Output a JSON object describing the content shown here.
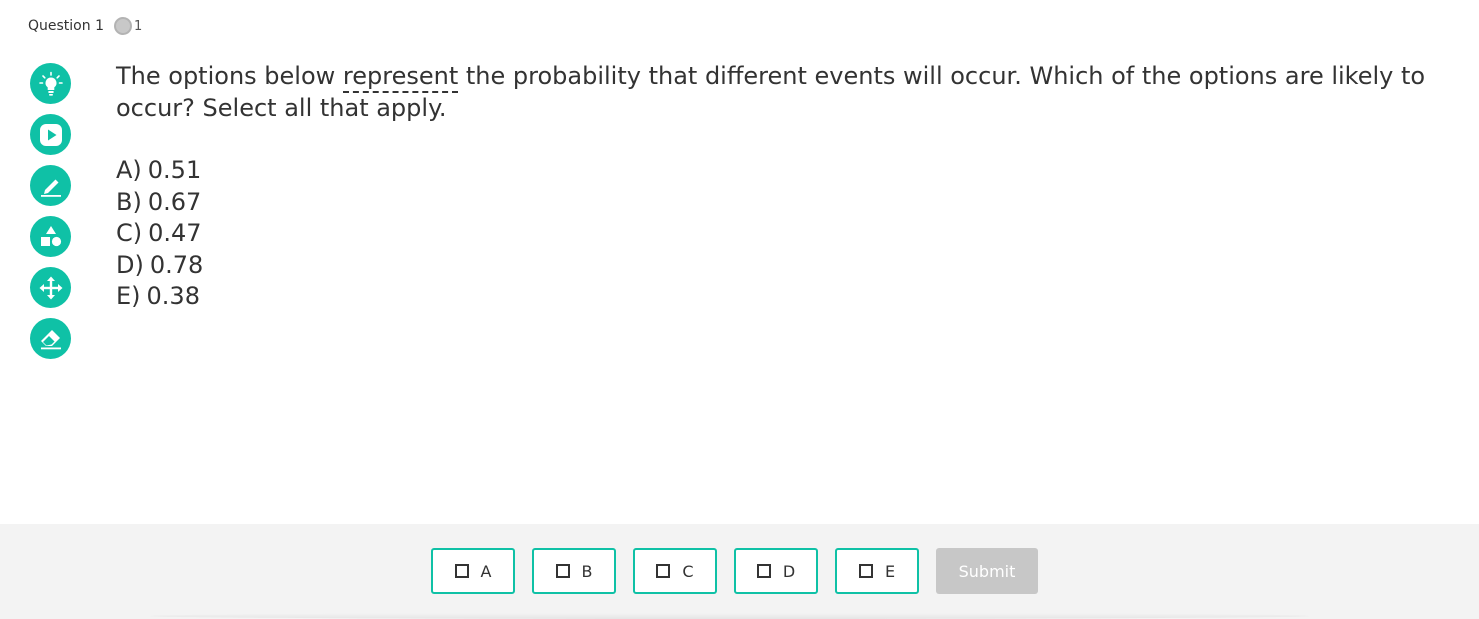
{
  "header": {
    "question_label": "Question 1",
    "points": "1"
  },
  "toolbar": {
    "tools": [
      {
        "name": "hint",
        "icon": "lightbulb-icon"
      },
      {
        "name": "video",
        "icon": "play-icon"
      },
      {
        "name": "scratchpad",
        "icon": "pencil-icon"
      },
      {
        "name": "manipulatives",
        "icon": "shapes-icon"
      },
      {
        "name": "move",
        "icon": "move-arrows-icon"
      },
      {
        "name": "eraser",
        "icon": "eraser-icon"
      }
    ]
  },
  "question": {
    "text_before": "The options below ",
    "glossary_term": "represent",
    "text_after": " the probability that different events will occur. Which of the options are likely to occur? Select all that apply."
  },
  "options": [
    {
      "label": "A)",
      "value": "0.51"
    },
    {
      "label": "B)",
      "value": "0.67"
    },
    {
      "label": "C)",
      "value": "0.47"
    },
    {
      "label": "D)",
      "value": "0.78"
    },
    {
      "label": "E)",
      "value": "0.38"
    }
  ],
  "answer_bar": {
    "choices": [
      "A",
      "B",
      "C",
      "D",
      "E"
    ],
    "submit_label": "Submit"
  },
  "colors": {
    "accent": "#0fc1a6",
    "submit_disabled": "#c7c7c7",
    "bar_background": "#f3f3f3"
  }
}
